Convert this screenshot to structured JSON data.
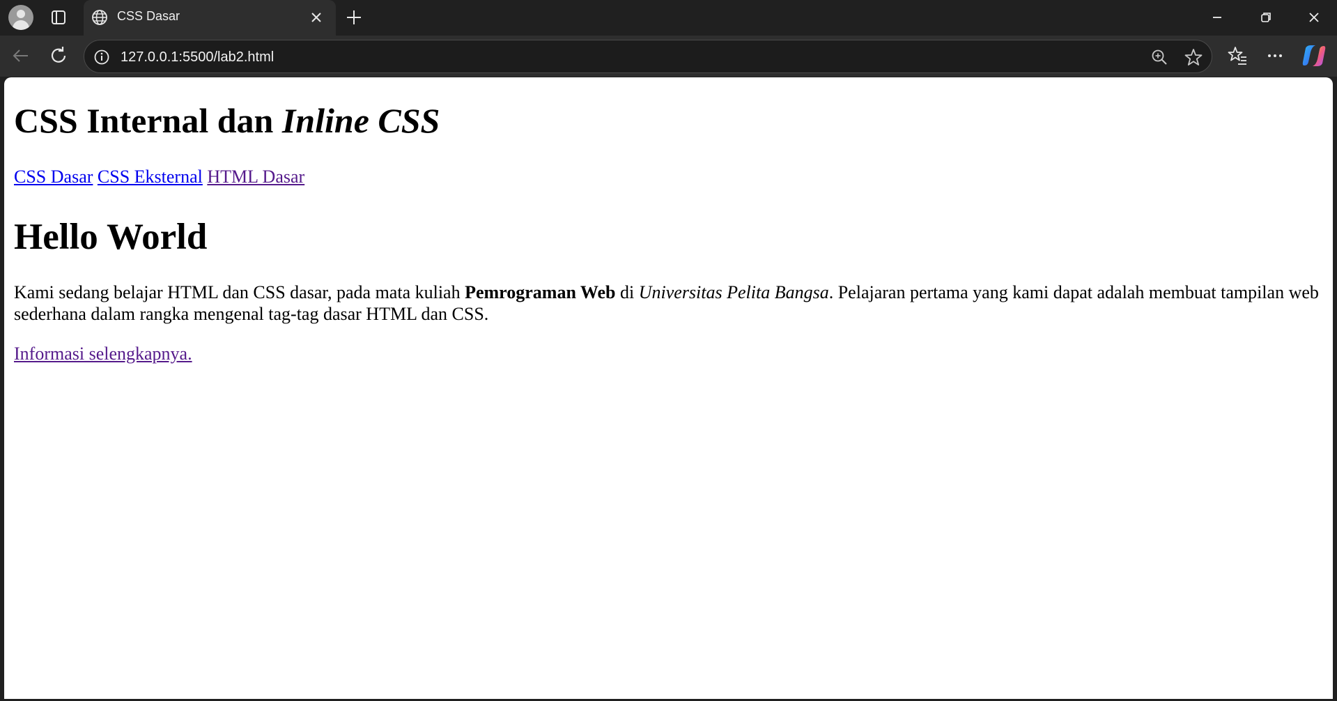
{
  "browser": {
    "tab": {
      "title": "CSS Dasar",
      "icon": "globe-icon"
    },
    "address": "127.0.0.1:5500/lab2.html",
    "accent": "#202020",
    "toolbar_bg": "#2e2e2e"
  },
  "page": {
    "heading": {
      "normal": "CSS Internal dan ",
      "italic": "Inline CSS"
    },
    "nav": [
      {
        "label": "CSS Dasar",
        "visited": false
      },
      {
        "label": "CSS Eksternal",
        "visited": false
      },
      {
        "label": "HTML Dasar",
        "visited": true
      }
    ],
    "hello": "Hello World",
    "paragraph": {
      "part1": "Kami sedang belajar HTML dan CSS dasar, pada mata kuliah ",
      "bold": "Pemrograman Web",
      "part2": " di ",
      "italic": "Universitas Pelita Bangsa",
      "part3": ". Pelajaran pertama yang kami dapat adalah membuat tampilan web sederhana dalam rangka mengenal tag-tag dasar HTML dan CSS."
    },
    "more_link": "Informasi selengkapnya.",
    "link_color": "#0000ee",
    "visited_color": "#551a8b"
  }
}
